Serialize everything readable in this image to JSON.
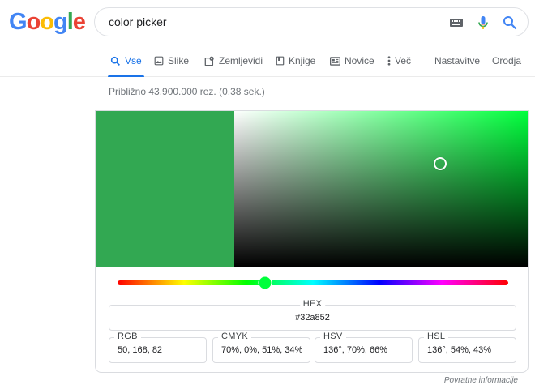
{
  "logo": {
    "letters": [
      "G",
      "o",
      "o",
      "g",
      "l",
      "e"
    ],
    "colors": [
      "#4285f4",
      "#ea4335",
      "#fbbc05",
      "#4285f4",
      "#34a853",
      "#ea4335"
    ]
  },
  "search": {
    "query": "color picker",
    "icons": [
      "keyboard-icon",
      "mic-icon",
      "search-icon"
    ]
  },
  "tabs": [
    {
      "label": "Vse",
      "icon": "search-icon",
      "active": true
    },
    {
      "label": "Slike",
      "icon": "image-icon"
    },
    {
      "label": "Zemljevidi",
      "icon": "map-icon"
    },
    {
      "label": "Knjige",
      "icon": "book-icon"
    },
    {
      "label": "Novice",
      "icon": "news-icon"
    },
    {
      "label": "Več",
      "icon": "more-vert-icon"
    },
    {
      "label": "Nastavitve"
    },
    {
      "label": "Orodja"
    }
  ],
  "stats": "Približno 43.900.000 rez. (0,38 sek.)",
  "picker": {
    "selected_color": "#32a852",
    "hue_color": "#00ff3c",
    "hue_degrees": 136,
    "saturation": 0.7,
    "value": 0.66,
    "hex": {
      "label": "HEX",
      "value": "#32a852"
    },
    "rgb": {
      "label": "RGB",
      "value": "50, 168, 82"
    },
    "cmyk": {
      "label": "CMYK",
      "value": "70%, 0%, 51%, 34%"
    },
    "hsv": {
      "label": "HSV",
      "value": "136°, 70%, 66%"
    },
    "hsl": {
      "label": "HSL",
      "value": "136°, 54%, 43%"
    }
  },
  "feedback": "Povratne informacije"
}
